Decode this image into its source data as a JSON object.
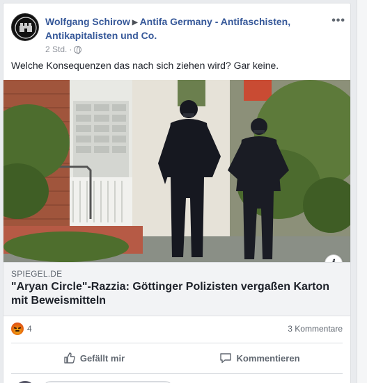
{
  "post": {
    "author": "Wolfgang Schirow",
    "group": "Antifa Germany - Antifaschisten, Antikapitalisten und Co.",
    "time": "2 Std.",
    "time_separator": "·",
    "privacy_icon": "globe-icon",
    "more_icon": "more-options-icon",
    "text": "Welche Konsequenzen das nach sich ziehen wird? Gar keine."
  },
  "link": {
    "source": "SPIEGEL.DE",
    "headline": "\"Aryan Circle\"-Razzia: Göttinger Polizisten vergaßen Karton mit Beweismitteln",
    "info_icon": "info-icon"
  },
  "stats": {
    "reaction_icon": "angry-reaction-icon",
    "reaction_count": "4",
    "comments": "3 Kommentare"
  },
  "actions": {
    "like_label": "Gefällt mir",
    "comment_label": "Kommentieren"
  },
  "colors": {
    "link_blue": "#365899",
    "text": "#1d2129",
    "muted": "#606770",
    "background": "#e9ebee"
  }
}
